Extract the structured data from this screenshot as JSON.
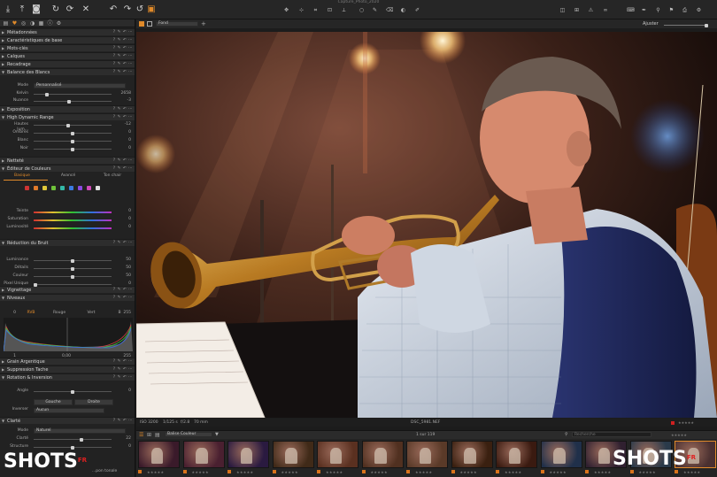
{
  "window_title": "Capture_Photo_2020",
  "toolbar": {
    "left_icons": [
      "import-icon",
      "export-icon",
      "camera-icon",
      "rotate-icon",
      "refresh-icon",
      "reset-icon",
      "close-icon"
    ],
    "cursor_tools": [
      "pan-icon",
      "picker-icon",
      "crop-icon",
      "keystone-icon",
      "spot-icon",
      "brush-icon",
      "eraser-icon",
      "gradient-icon"
    ],
    "right_icons": [
      "compare-icon",
      "grid-icon",
      "warn-icon",
      "loupe-icon",
      "keyboard-icon",
      "tag-icon",
      "pen-icon",
      "copy-icon",
      "paste-icon",
      "print-icon",
      "settings-icon"
    ]
  },
  "left_panel": {
    "sections": [
      {
        "key": "metadata",
        "label": "Métadonnées",
        "collapsed": true
      },
      {
        "key": "base",
        "label": "Caractéristiques de base",
        "collapsed": true
      },
      {
        "key": "keywords",
        "label": "Mots-clés",
        "collapsed": true
      },
      {
        "key": "layers",
        "label": "Calques",
        "collapsed": true
      },
      {
        "key": "crop",
        "label": "Recadrage",
        "collapsed": true
      },
      {
        "key": "wb",
        "label": "Balance des Blancs",
        "collapsed": false
      },
      {
        "key": "exposure",
        "label": "Exposition",
        "collapsed": true
      },
      {
        "key": "hdr",
        "label": "High Dynamic Range",
        "collapsed": false
      },
      {
        "key": "sharpen",
        "label": "Netteté",
        "collapsed": true
      },
      {
        "key": "color",
        "label": "Éditeur de Couleurs",
        "collapsed": false
      },
      {
        "key": "noise",
        "label": "Réduction du Bruit",
        "collapsed": false
      },
      {
        "key": "vignette",
        "label": "Vignettage",
        "collapsed": true
      },
      {
        "key": "levels",
        "label": "Niveaux",
        "collapsed": false
      },
      {
        "key": "grain",
        "label": "Grain Argentique",
        "collapsed": true
      },
      {
        "key": "spot",
        "label": "Suppression Tache",
        "collapsed": true
      },
      {
        "key": "rotation",
        "label": "Rotation & Inversion",
        "collapsed": false
      },
      {
        "key": "clarity",
        "label": "Clarté",
        "collapsed": false
      }
    ],
    "wb": {
      "mode_label": "Mode",
      "mode_value": "Personnalisé",
      "kelvin_label": "Kelvin",
      "kelvin_value": "2658",
      "tint_label": "Nuance",
      "tint_value": "-3",
      "kelvin_pos": 0.15,
      "tint_pos": 0.45
    },
    "hdr": {
      "rows": [
        {
          "label": "Hautes lum...",
          "value": "-12",
          "pos": 0.44
        },
        {
          "label": "Ombres",
          "value": "0",
          "pos": 0.5
        },
        {
          "label": "Blanc",
          "value": "0",
          "pos": 0.5
        },
        {
          "label": "Noir",
          "value": "0",
          "pos": 0.5
        }
      ]
    },
    "color": {
      "tabs": [
        "Basique",
        "Avancé",
        "Ton chair"
      ],
      "swatches": [
        "#cc3333",
        "#e07a2a",
        "#e0c83a",
        "#6fc23a",
        "#33b8a6",
        "#3a7ae0",
        "#8a4ae0",
        "#d04ab8",
        "#e0e0e0"
      ],
      "rows": [
        {
          "label": "Teinte",
          "value": "0"
        },
        {
          "label": "Saturation",
          "value": "0"
        },
        {
          "label": "Luminosité",
          "value": "0"
        }
      ]
    },
    "noise": {
      "rows": [
        {
          "label": "Luminance",
          "value": "50",
          "pos": 0.5
        },
        {
          "label": "Détails",
          "value": "50",
          "pos": 0.5
        },
        {
          "label": "Couleur",
          "value": "50",
          "pos": 0.5
        },
        {
          "label": "Pixel Unique",
          "value": "0",
          "pos": 0.0
        }
      ]
    },
    "levels": {
      "low": "0",
      "channels": [
        "RVB",
        "Rouge",
        "Vert",
        "B"
      ],
      "high": "255",
      "out_low": "1",
      "mid": "0,00",
      "out_high": "255"
    },
    "rotation": {
      "angle_label": "Angle",
      "angle_value": "0",
      "left_button": "Gauche",
      "right_button": "Droite",
      "invert_label": "Inverser",
      "invert_value": "Aucun"
    },
    "clarity": {
      "mode_label": "Mode",
      "mode_value": "Naturel",
      "clarity_label": "Clarté",
      "clarity_value": "22",
      "structure_label": "Structure",
      "structure_value": "0",
      "footer": "...pon tonale"
    }
  },
  "viewer": {
    "profile": "Fond",
    "zoom_label": "Ajuster",
    "exif": {
      "iso": "ISO 3200",
      "shutter": "1/125 s",
      "aperture": "f/2.8",
      "focal": "70 mm"
    },
    "filename": "DSC_5981.NEF"
  },
  "browser": {
    "sort": "Balise Couleur",
    "count": "1 sur 119",
    "search_placeholder": "Recherche",
    "thumbnails": 13
  },
  "watermark": {
    "text": "SHOTS",
    "suffix": "FR"
  }
}
